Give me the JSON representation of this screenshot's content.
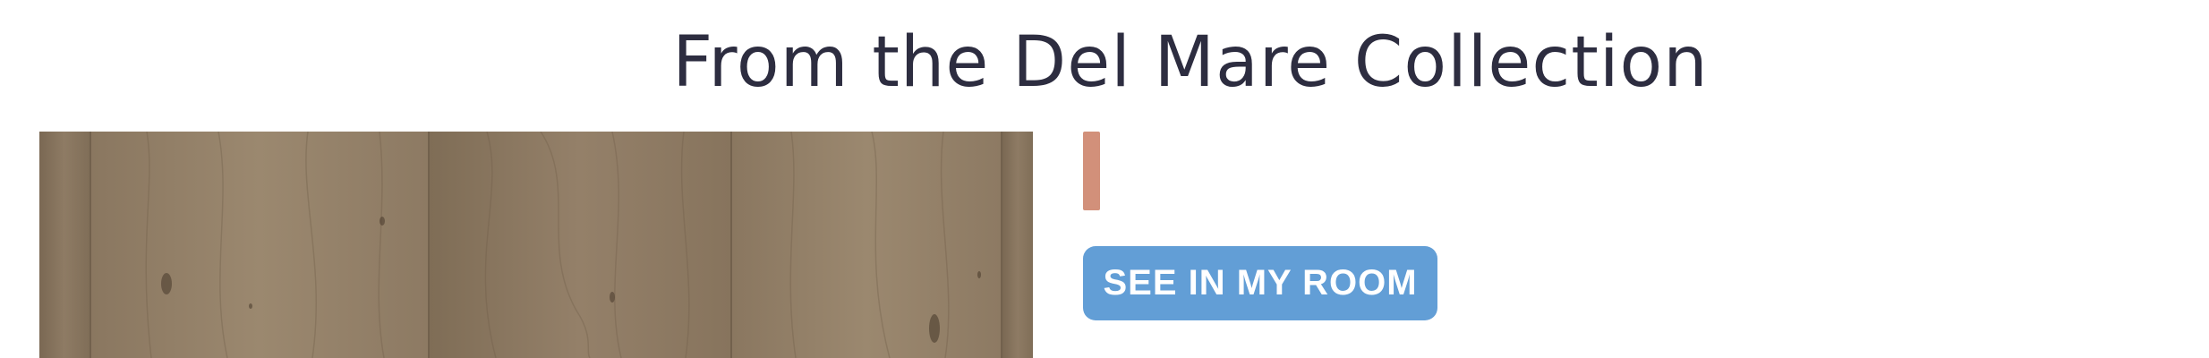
{
  "collection": {
    "title": "From the Del Mare Collection"
  },
  "product_image": {
    "icon": "wood-floor-sample-image"
  },
  "actions": {
    "see_in_room_label": "SEE IN MY ROOM"
  },
  "colors": {
    "title_text": "#2d2d40",
    "accent_bar": "#d2907a",
    "button_bg": "#629ed6",
    "button_text": "#ffffff",
    "wood_base": "#8c7a62",
    "wood_light": "#9a8770",
    "wood_dark": "#6f5d48"
  }
}
